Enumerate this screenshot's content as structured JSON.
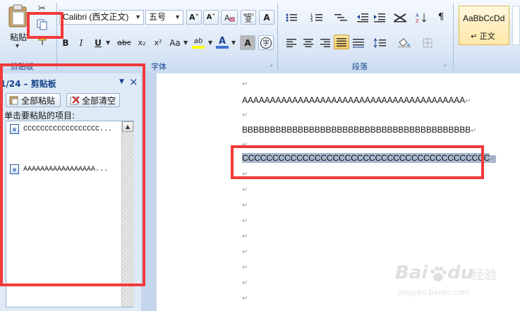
{
  "clipboard_group": {
    "paste_label": "粘贴",
    "paste_arrow": "▾",
    "label": "剪贴板"
  },
  "font_group": {
    "font_name": "Calibri (西文正文)",
    "font_size": "五号",
    "grow_label": "A˄",
    "shrink_label": "A˅",
    "clear_label": "A",
    "phonetic_label": "wén",
    "phonetic_sub": "变",
    "border_label": "A",
    "bold": "B",
    "italic": "I",
    "underline": "U",
    "strike": "abc",
    "subscript": "x₂",
    "superscript": "x²",
    "case": "Aa",
    "highlight": "ab",
    "font_color": "A",
    "shade": "A",
    "enclose": "字",
    "label": "字体"
  },
  "paragraph_group": {
    "label": "段落"
  },
  "styles_group": {
    "sample": "AaBbCcDd",
    "style_name": "↵ 正文"
  },
  "task_pane": {
    "title": "1/24 – 剪贴板",
    "paste_all": "全部粘贴",
    "clear_all": "全部清空",
    "instruction": "单击要粘贴的项目:",
    "items": [
      {
        "text": "CCCCCCCCCCCCCCCCCC..."
      },
      {
        "text": "AAAAAAAAAAAAAAAAA..."
      }
    ],
    "word_icon_letter": "W",
    "close": "×",
    "menu_arrow": "▼"
  },
  "document": {
    "lines": [
      {
        "text": "AAAAAAAAAAAAAAAAAAAAAAAAAAAAAAAAAAAAAAAA",
        "mark": "↵"
      },
      {
        "text": "BBBBBBBBBBBBBBBBBBBBBBBBBBBBBBBBBBBBBBBBB",
        "mark": "↵"
      },
      {
        "text": "CCCCCCCCCCCCCCCCCCCCCCCCCCCCCCCCCCCCCCCCC",
        "mark": "↵"
      }
    ],
    "empty_mark": "↵"
  },
  "watermark": {
    "brand": "Bai",
    "brand_suffix": "du",
    "product": "经验",
    "url": "jingyan.baidu.com"
  },
  "colors": {
    "annotation_red": "#f23a3a",
    "selection": "#a9b9d1",
    "ribbon_text": "#15428b"
  }
}
